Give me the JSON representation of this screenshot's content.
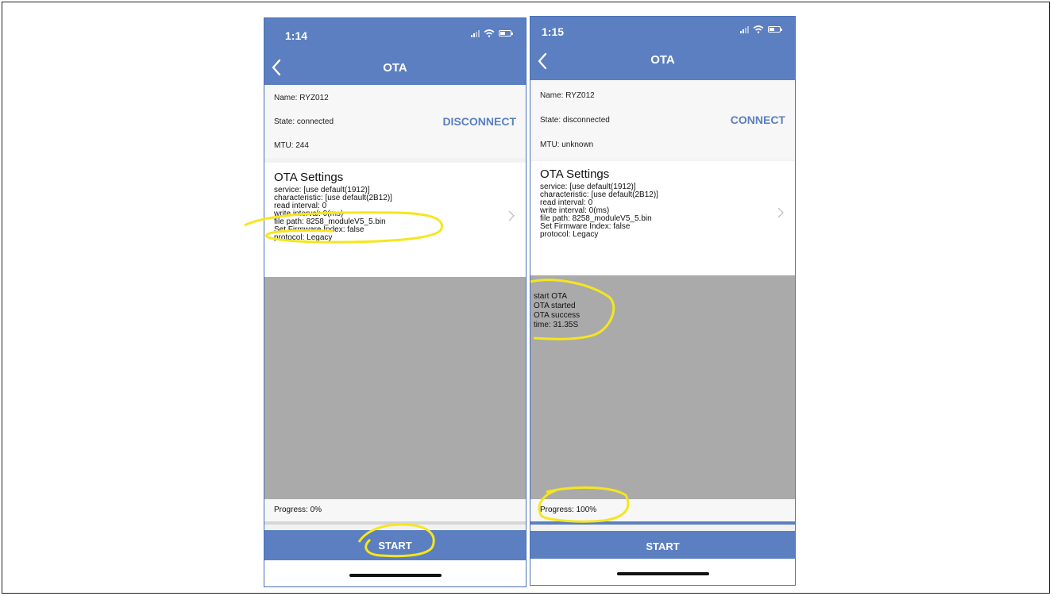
{
  "screens": [
    {
      "time": "1:14",
      "nav_title": "OTA",
      "name": "Name: RYZ012",
      "state": "State: connected",
      "connection_button": "DISCONNECT",
      "mtu": "MTU: 244",
      "settings_title": "OTA Settings",
      "settings_lines": [
        "service: [use default(1912)]",
        "characteristic: [use default(2B12)]",
        "read interval: 0",
        "write interval: 0(ms)",
        "file path: 8258_moduleV5_5.bin",
        "Set Firmware Index: false",
        "protocol: Legacy"
      ],
      "log_lines": [],
      "progress_text": "Progress: 0%",
      "progress_fraction": 0,
      "start_label": "START"
    },
    {
      "time": "1:15",
      "nav_title": "OTA",
      "name": "Name: RYZ012",
      "state": "State: disconnected",
      "connection_button": "CONNECT",
      "mtu": "MTU: unknown",
      "settings_title": "OTA Settings",
      "settings_lines": [
        "service: [use default(1912)]",
        "characteristic: [use default(2B12)]",
        "read interval: 0",
        "write interval: 0(ms)",
        "file path: 8258_moduleV5_5.bin",
        "Set Firmware Index: false",
        "protocol: Legacy"
      ],
      "log_lines": [
        "start OTA",
        "OTA started",
        "OTA success",
        "time: 31.35S"
      ],
      "progress_text": "Progress: 100%",
      "progress_fraction": 1,
      "start_label": "START"
    }
  ],
  "colors": {
    "accent": "#5b7fc0",
    "highlight": "#f5e61e",
    "log_background": "#aaaaaa"
  }
}
